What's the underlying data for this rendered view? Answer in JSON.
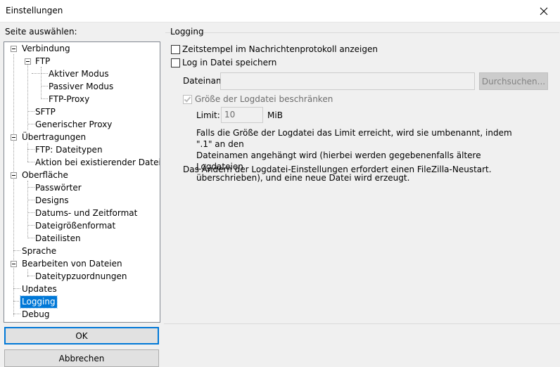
{
  "window": {
    "title": "Einstellungen"
  },
  "sidebar": {
    "label": "Seite auswählen:",
    "tree": [
      {
        "label": "Verbindung"
      },
      {
        "label": "FTP"
      },
      {
        "label": "Aktiver Modus"
      },
      {
        "label": "Passiver Modus"
      },
      {
        "label": "FTP-Proxy"
      },
      {
        "label": "SFTP"
      },
      {
        "label": "Generischer Proxy"
      },
      {
        "label": "Übertragungen"
      },
      {
        "label": "FTP: Dateitypen"
      },
      {
        "label": "Aktion bei existierender Datei"
      },
      {
        "label": "Oberfläche"
      },
      {
        "label": "Passwörter"
      },
      {
        "label": "Designs"
      },
      {
        "label": "Datums- und Zeitformat"
      },
      {
        "label": "Dateigrößenformat"
      },
      {
        "label": "Dateilisten"
      },
      {
        "label": "Sprache"
      },
      {
        "label": "Bearbeiten von Dateien"
      },
      {
        "label": "Dateitypzuordnungen"
      },
      {
        "label": "Updates"
      },
      {
        "label": "Logging",
        "selected": true
      },
      {
        "label": "Debug"
      }
    ],
    "ok_label": "OK",
    "cancel_label": "Abbrechen"
  },
  "logging": {
    "group_title": "Logging",
    "timestamps_label": "Zeitstempel im Nachrichtenprotokoll anzeigen",
    "timestamps_checked": false,
    "log_to_file_label": "Log in Datei speichern",
    "log_to_file_checked": false,
    "filename_label": "Dateiname:",
    "filename_value": "",
    "browse_label": "Durchsuchen...",
    "limit_size_label": "Größe der Logdatei beschränken",
    "limit_size_checked": true,
    "limit_label": "Limit:",
    "limit_value": "10",
    "limit_unit": "MiB",
    "info_text": "Falls die Größe der Logdatei das Limit erreicht, wird sie umbenannt, indem \".1\" an den\nDateinamen angehängt wird (hierbei werden gegebenenfalls ältere Logdateien\nüberschrieben), und eine neue Datei wird erzeugt.",
    "restart_note": "Das Ändern der Logdatei-Einstellungen erfordert einen FileZilla-Neustart."
  }
}
